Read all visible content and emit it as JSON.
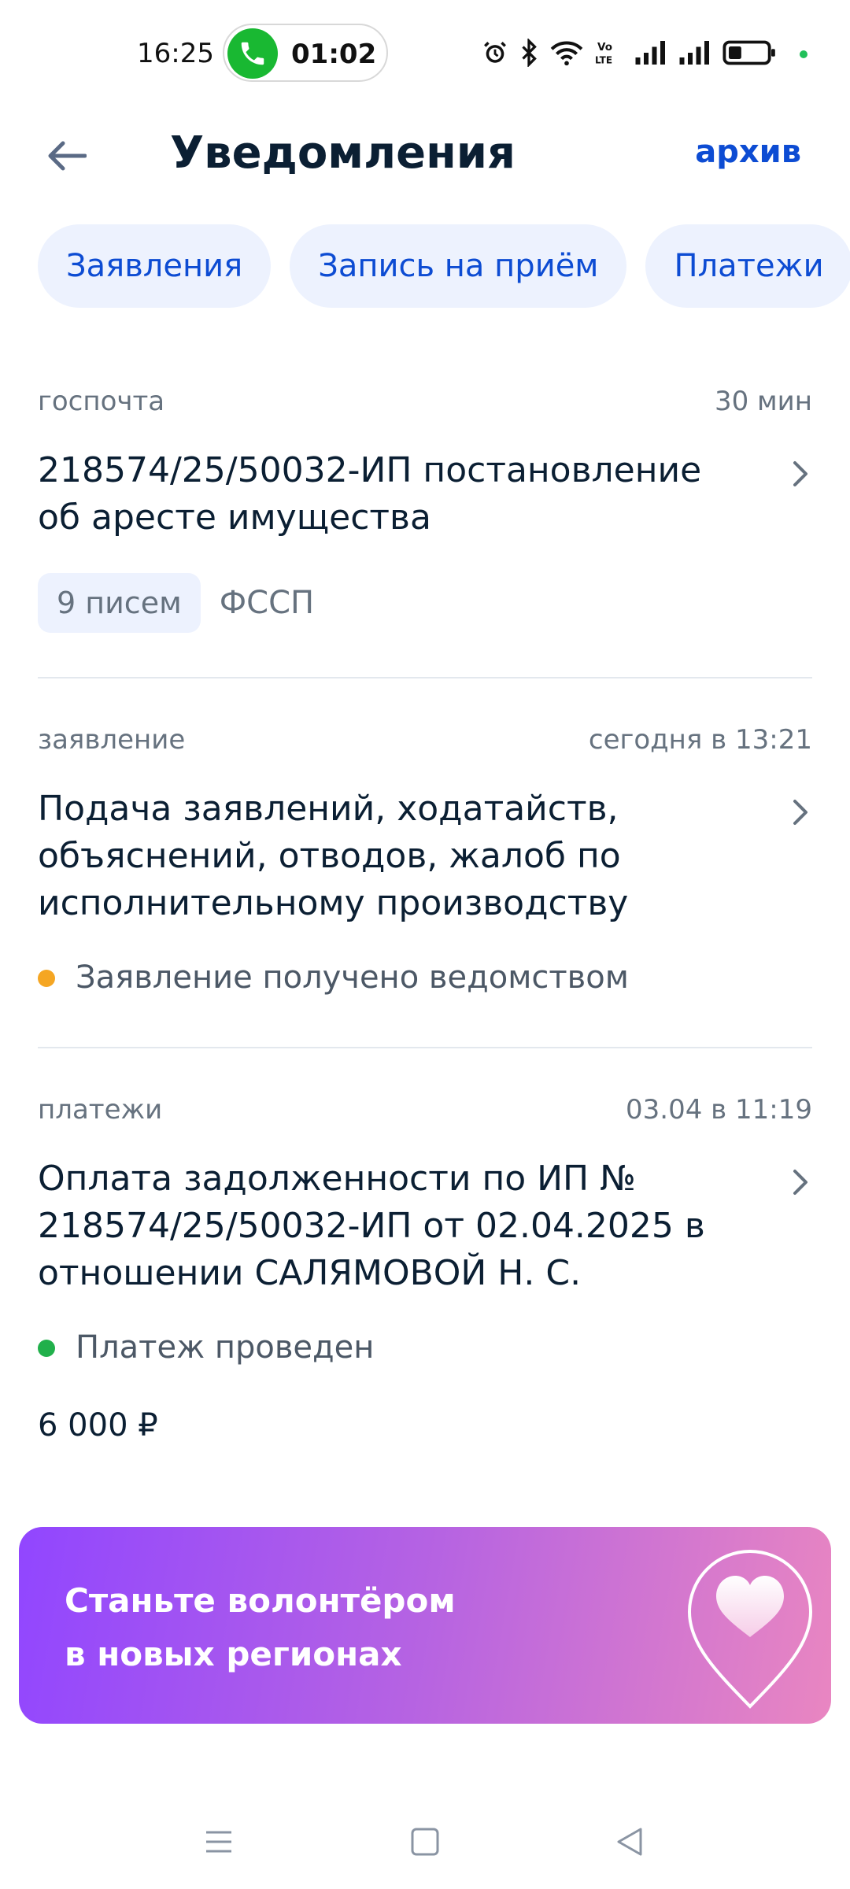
{
  "status_bar": {
    "time": "16:25",
    "call_duration": "01:02",
    "icons": [
      "alarm-icon",
      "bluetooth-icon",
      "wifi-icon",
      "volte-icon",
      "signal-1-icon",
      "signal-2-icon",
      "battery-icon"
    ],
    "accent_green": "#19b832"
  },
  "header": {
    "title": "Уведомления",
    "archive_label": "архив",
    "back_icon": "arrow-left-icon"
  },
  "tabs": [
    {
      "label": "Заявления"
    },
    {
      "label": "Запись на приём"
    },
    {
      "label": "Платежи"
    }
  ],
  "notifications": [
    {
      "category": "госпочта",
      "time": "30 мин",
      "title": "218574/25/50032-ИП постановление об аресте имущества",
      "letters_count": "9 писем",
      "organization": "ФССП"
    },
    {
      "category": "заявление",
      "time": "сегодня в 13:21",
      "title": "Подача заявлений, ходатайств, объяснений, отводов, жалоб по исполнительному производству",
      "status": "Заявление получено ведомством",
      "status_color": "#f5a623"
    },
    {
      "category": "платежи",
      "time": "03.04 в 11:19",
      "title": "Оплата задолженности по ИП № 218574/25/50032-ИП от 02.04.2025 в отношении САЛЯМОВОЙ Н. С.",
      "status": "Платеж проведен",
      "status_color": "#21b04b",
      "amount": "6 000 ₽"
    }
  ],
  "banner": {
    "line1": "Станьте волонтёром",
    "line2": "в новых регионах",
    "icon": "heart-pin-icon"
  },
  "nav_bar": {
    "icons": [
      "menu-icon",
      "home-square-icon",
      "back-triangle-icon"
    ]
  },
  "colors": {
    "brand_blue": "#0d4cd3",
    "chip_bg": "#edf2fe",
    "text_primary": "#0b1f33",
    "text_secondary": "#66727f"
  }
}
